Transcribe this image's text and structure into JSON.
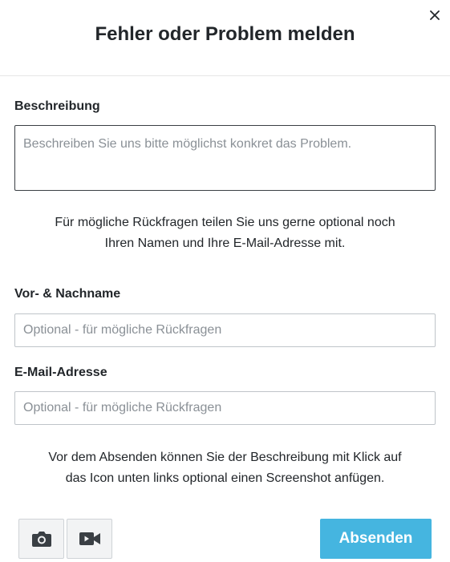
{
  "dialog": {
    "title": "Fehler oder Problem melden",
    "close_icon": "close-icon"
  },
  "description": {
    "label": "Beschreibung",
    "placeholder": "Beschreiben Sie uns bitte möglichst konkret das Problem.",
    "value": ""
  },
  "contact_info": {
    "line1": "Für mögliche Rückfragen teilen Sie uns gerne optional noch",
    "line2": "Ihren Namen und Ihre E-Mail-Adresse mit."
  },
  "name_field": {
    "label": "Vor- & Nachname",
    "placeholder": "Optional - für mögliche Rückfragen",
    "value": ""
  },
  "email_field": {
    "label": "E-Mail-Adresse",
    "placeholder": "Optional - für mögliche Rückfragen",
    "value": ""
  },
  "screenshot_info": {
    "line1": "Vor dem Absenden können Sie der Beschreibung mit Klick auf",
    "line2": "das Icon unten links optional einen Screenshot anfügen."
  },
  "footer": {
    "screenshot_icon": "camera-icon",
    "video_icon": "video-camera-icon",
    "submit_label": "Absenden"
  },
  "colors": {
    "accent": "#45b5e0",
    "text": "#22262a",
    "border": "#bfc4c9"
  }
}
